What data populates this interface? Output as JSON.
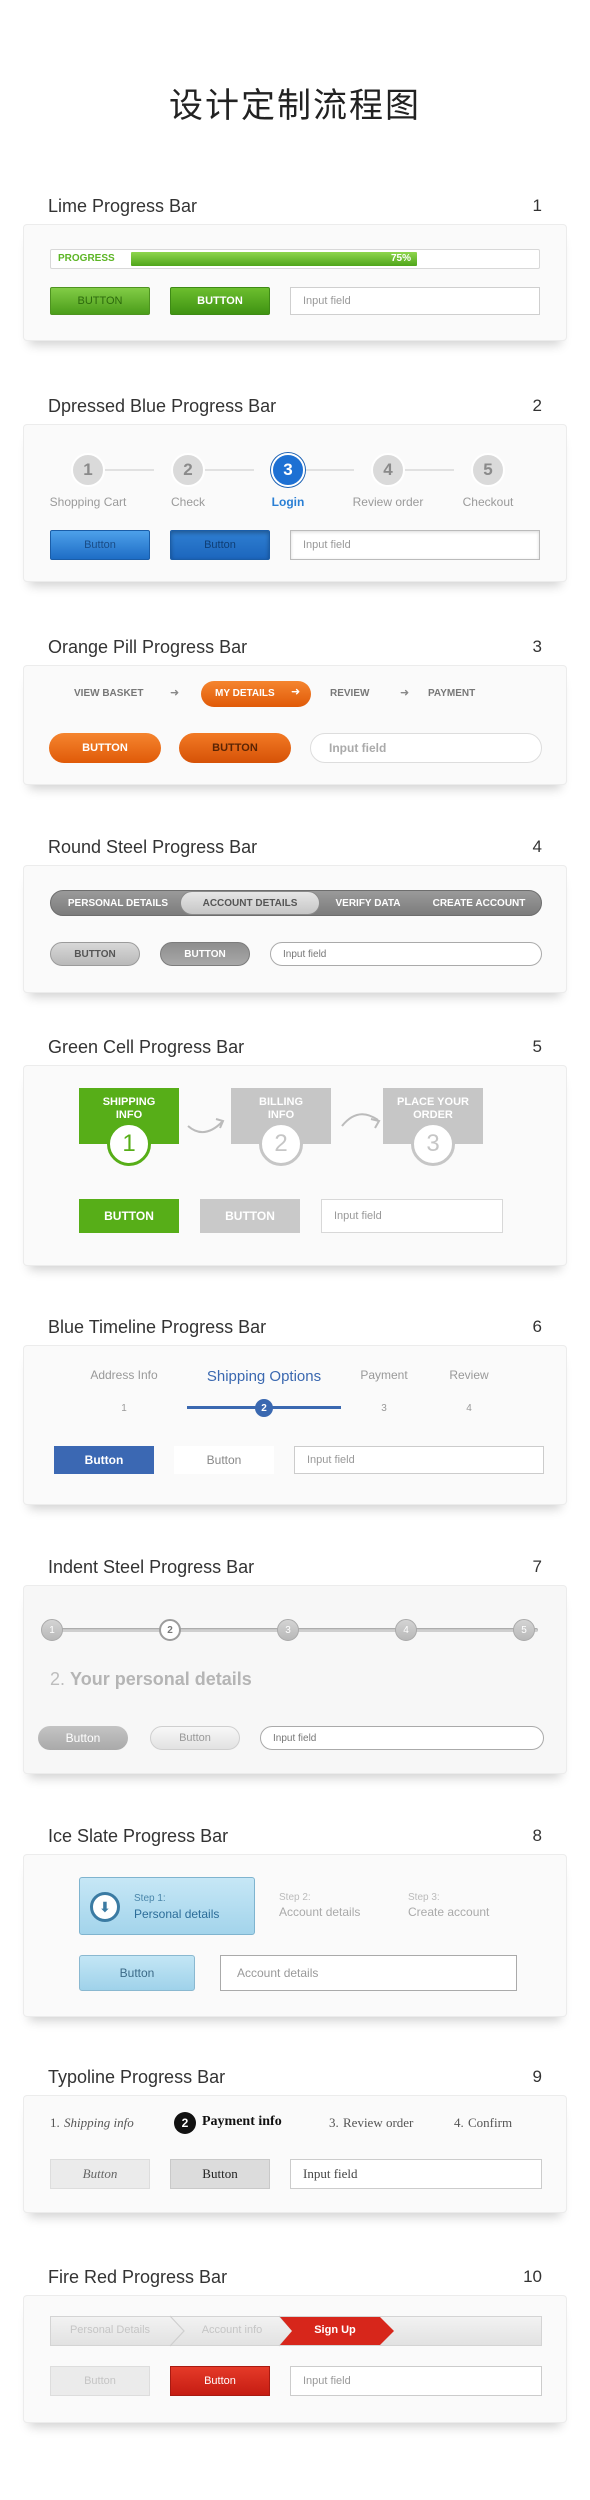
{
  "page_title": "设计定制流程图",
  "s1": {
    "title": "Lime Progress Bar",
    "num": "1",
    "bar_label": "PROGRESS",
    "percent_label": "75%",
    "progress": 0.75,
    "btn1": "BUTTON",
    "btn2": "BUTTON",
    "input_placeholder": "Input field",
    "accent": "#5cb524"
  },
  "s2": {
    "title": "Dpressed Blue Progress Bar",
    "num": "2",
    "steps": [
      {
        "n": "1",
        "label": "Shopping Cart"
      },
      {
        "n": "2",
        "label": "Check"
      },
      {
        "n": "3",
        "label": "Login"
      },
      {
        "n": "4",
        "label": "Review order"
      },
      {
        "n": "5",
        "label": "Checkout"
      }
    ],
    "active_step": 3,
    "btn1": "Button",
    "btn2": "Button",
    "input_placeholder": "Input field",
    "accent": "#2a7fd4"
  },
  "s3": {
    "title": "Orange Pill Progress Bar",
    "num": "3",
    "steps": [
      "VIEW BASKET",
      "MY DETAILS",
      "REVIEW",
      "PAYMENT"
    ],
    "active_step": 2,
    "btn1": "BUTTON",
    "btn2": "BUTTON",
    "input_placeholder": "Input field",
    "accent": "#ee6411"
  },
  "s4": {
    "title": "Round Steel Progress Bar",
    "num": "4",
    "steps": [
      "PERSONAL DETAILS",
      "ACCOUNT DETAILS",
      "VERIFY DATA",
      "CREATE ACCOUNT"
    ],
    "active_step": 2,
    "btn1": "BUTTON",
    "btn2": "BUTTON",
    "input_placeholder": "Input field"
  },
  "s5": {
    "title": "Green Cell Progress Bar",
    "num": "5",
    "steps": [
      {
        "l1": "SHIPPING",
        "l2": "INFO",
        "n": "1"
      },
      {
        "l1": "BILLING",
        "l2": "INFO",
        "n": "2"
      },
      {
        "l1": "PLACE YOUR",
        "l2": "ORDER",
        "n": "3"
      }
    ],
    "active_step": 1,
    "btn1": "BUTTON",
    "btn2": "BUTTON",
    "input_placeholder": "Input field",
    "accent": "#55b114"
  },
  "s6": {
    "title": "Blue Timeline Progress Bar",
    "num": "6",
    "steps": [
      {
        "label": "Address Info",
        "n": "1"
      },
      {
        "label": "Shipping Options",
        "n": "2"
      },
      {
        "label": "Payment",
        "n": "3"
      },
      {
        "label": "Review",
        "n": "4"
      }
    ],
    "active_step": 2,
    "btn1": "Button",
    "btn2": "Button",
    "input_placeholder": "Input field",
    "accent": "#3a68b0"
  },
  "s7": {
    "title": "Indent Steel Progress Bar",
    "num": "7",
    "steps": [
      "1",
      "2",
      "3",
      "4",
      "5"
    ],
    "active_step": 2,
    "heading_num": "2.",
    "heading_text": "Your personal details",
    "btn1": "Button",
    "btn2": "Button",
    "input_placeholder": "Input field"
  },
  "s8": {
    "title": "Ice Slate Progress Bar",
    "num": "8",
    "steps": [
      {
        "small": "Step 1:",
        "label": "Personal details"
      },
      {
        "small": "Step 2:",
        "label": "Account details"
      },
      {
        "small": "Step 3:",
        "label": "Create account"
      }
    ],
    "active_step": 1,
    "btn1": "Button",
    "input_placeholder": "Account details"
  },
  "s9": {
    "title": "Typoline Progress Bar",
    "num": "9",
    "steps": [
      {
        "n": "1.",
        "label": "Shipping info"
      },
      {
        "n": "2",
        "label": "Payment info"
      },
      {
        "n": "3.",
        "label": "Review order"
      },
      {
        "n": "4.",
        "label": "Confirm"
      }
    ],
    "active_step": 2,
    "btn1": "Button",
    "btn2": "Button",
    "input_placeholder": "Input field"
  },
  "s10": {
    "title": "Fire Red Progress Bar",
    "num": "10",
    "steps": [
      "Personal Details",
      "Account info",
      "Sign Up"
    ],
    "active_step": 3,
    "btn1": "Button",
    "btn2": "Button",
    "input_placeholder": "Input field",
    "accent": "#d7261b"
  }
}
